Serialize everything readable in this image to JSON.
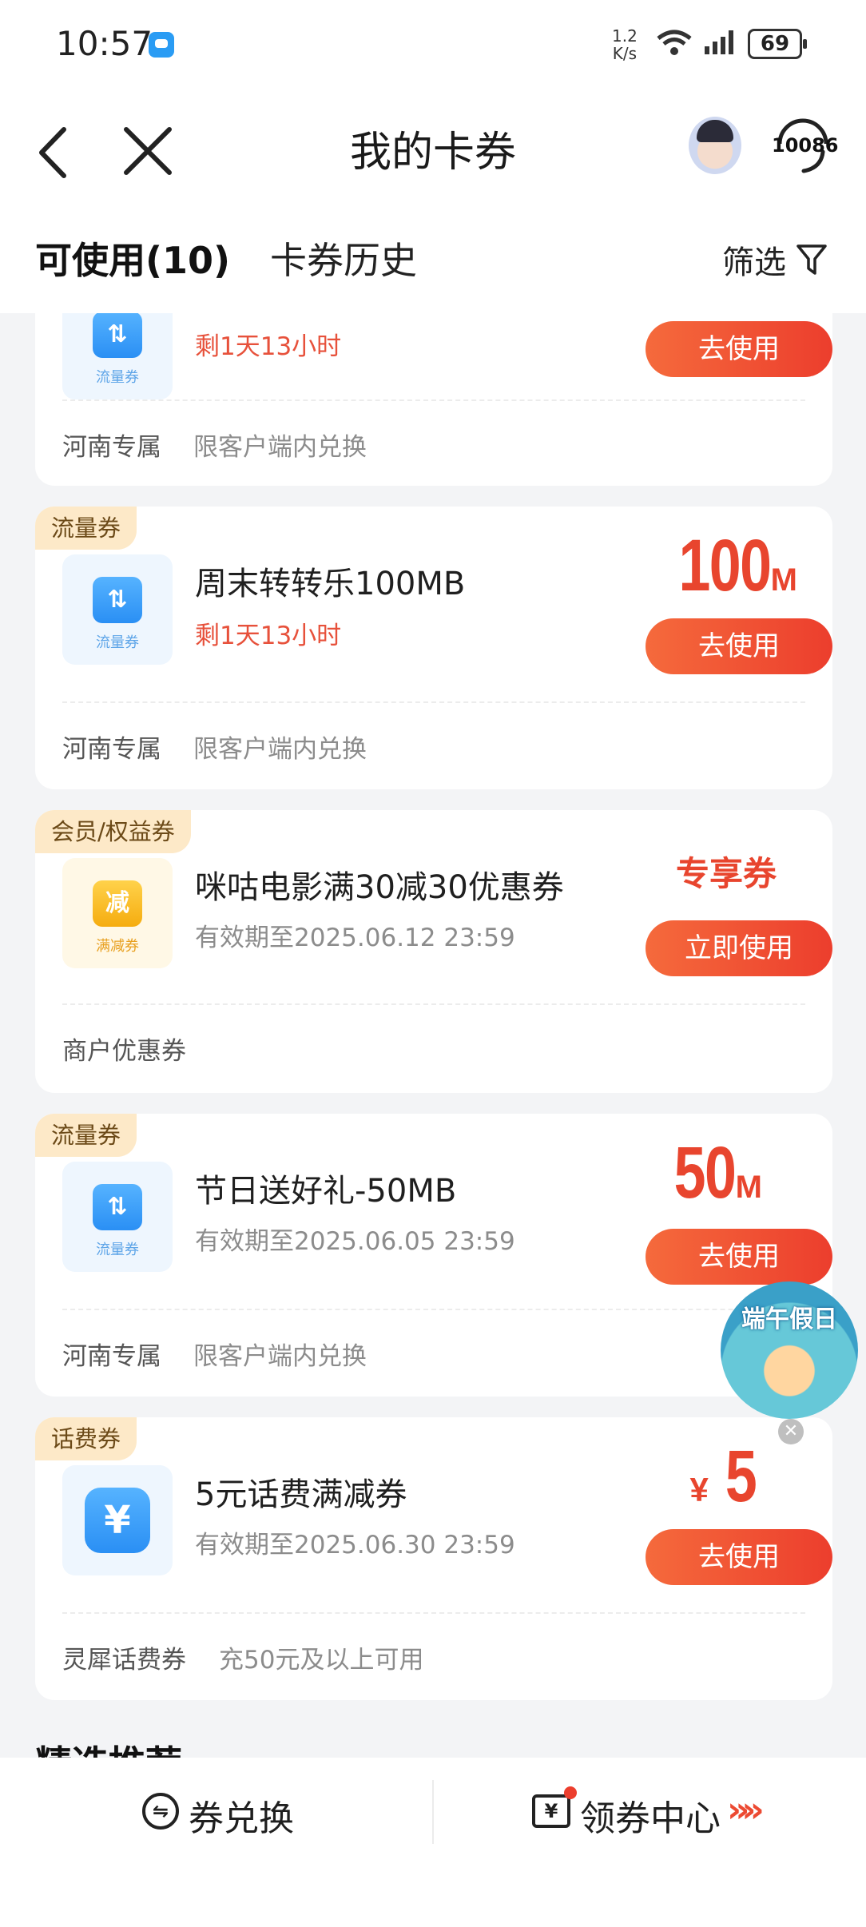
{
  "status_bar": {
    "time": "10:57",
    "net_speed_value": "1.2",
    "net_speed_unit": "K/s",
    "battery": "69"
  },
  "header": {
    "title": "我的卡券",
    "service_label": "10086"
  },
  "tabs": {
    "available": "可使用(10)",
    "history": "卡券历史",
    "filter": "筛选"
  },
  "coupons": [
    {
      "badge": "",
      "icon": "data-coupon-icon",
      "thumb_label": "流量券",
      "title": "",
      "subtitle": "剩1天13小时",
      "button": "去使用",
      "foot1": "河南专属",
      "foot2": "限客户端内兑换"
    },
    {
      "badge": "流量券",
      "icon": "data-coupon-icon",
      "thumb_label": "流量券",
      "title": "周末转转乐100MB",
      "subtitle": "剩1天13小时",
      "value_num": "100",
      "value_unit": "M",
      "button": "去使用",
      "foot1": "河南专属",
      "foot2": "限客户端内兑换"
    },
    {
      "badge": "会员/权益券",
      "icon": "discount-coupon-icon",
      "thumb_glyph": "减",
      "thumb_label": "满减券",
      "title": "咪咕电影满30减30优惠券",
      "subtitle": "有效期至2025.06.12 23:59",
      "value_text": "专享券",
      "button": "立即使用",
      "foot1": "商户优惠券"
    },
    {
      "badge": "流量券",
      "icon": "data-coupon-icon",
      "thumb_label": "流量券",
      "title": "节日送好礼-50MB",
      "subtitle": "有效期至2025.06.05 23:59",
      "value_num": "50",
      "value_unit": "M",
      "button": "去使用",
      "foot1": "河南专属",
      "foot2": "限客户端内兑换"
    },
    {
      "badge": "话费券",
      "icon": "yuan-icon",
      "thumb_glyph": "¥",
      "title": "5元话费满减券",
      "subtitle": "有效期至2025.06.30 23:59",
      "value_prefix": "¥",
      "value_num": "5",
      "button": "去使用",
      "foot1": "灵犀话费券",
      "foot2": "充50元及以上可用"
    }
  ],
  "section_title": "精选推荐",
  "floating_banner": {
    "text": "端午假日"
  },
  "bottom_bar": {
    "exchange": "券兑换",
    "center": "领券中心",
    "arrows": "»»"
  }
}
